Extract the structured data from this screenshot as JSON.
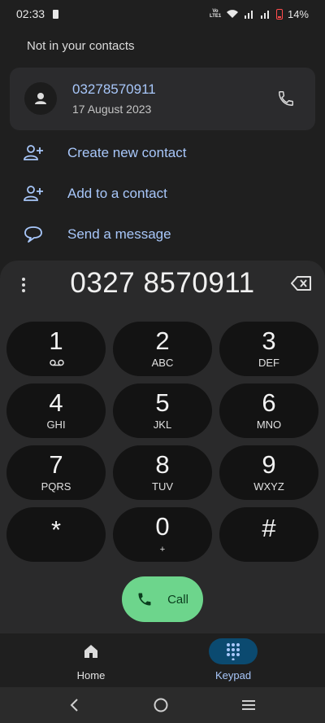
{
  "status": {
    "time": "02:33",
    "volte": "Vo LTE1",
    "battery": "14%"
  },
  "section_label": "Not in your contacts",
  "recent": {
    "number": "03278570911",
    "date": "17 August 2023"
  },
  "actions": [
    {
      "label": "Create new contact",
      "icon": "add-person-icon"
    },
    {
      "label": "Add to a contact",
      "icon": "add-person-icon"
    },
    {
      "label": "Send a message",
      "icon": "message-icon"
    }
  ],
  "dialer": {
    "number": "0327 8570911"
  },
  "keys": [
    {
      "digit": "1",
      "letters": ""
    },
    {
      "digit": "2",
      "letters": "ABC"
    },
    {
      "digit": "3",
      "letters": "DEF"
    },
    {
      "digit": "4",
      "letters": "GHI"
    },
    {
      "digit": "5",
      "letters": "JKL"
    },
    {
      "digit": "6",
      "letters": "MNO"
    },
    {
      "digit": "7",
      "letters": "PQRS"
    },
    {
      "digit": "8",
      "letters": "TUV"
    },
    {
      "digit": "9",
      "letters": "WXYZ"
    },
    {
      "digit": "*",
      "letters": ""
    },
    {
      "digit": "0",
      "letters": "+"
    },
    {
      "digit": "#",
      "letters": ""
    }
  ],
  "call_button": {
    "label": "Call"
  },
  "nav": {
    "home": "Home",
    "keypad": "Keypad"
  },
  "colors": {
    "accent": "#a8c7fa",
    "call_green": "#6dd58c",
    "active_pill": "#0b4a70"
  }
}
